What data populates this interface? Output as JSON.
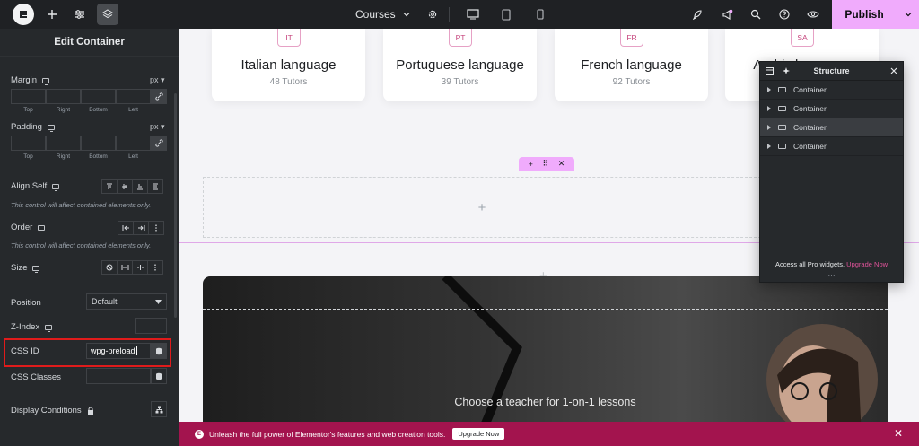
{
  "topbar": {
    "page_name": "Courses",
    "publish_label": "Publish"
  },
  "panel": {
    "title": "Edit Container",
    "margin": {
      "label": "Margin",
      "unit": "px",
      "sides": [
        "Top",
        "Right",
        "Bottom",
        "Left"
      ]
    },
    "padding": {
      "label": "Padding",
      "unit": "px",
      "sides": [
        "Top",
        "Right",
        "Bottom",
        "Left"
      ]
    },
    "align_self": {
      "label": "Align Self",
      "hint": "This control will affect contained elements only."
    },
    "order": {
      "label": "Order",
      "hint": "This control will affect contained elements only."
    },
    "size": {
      "label": "Size"
    },
    "position": {
      "label": "Position",
      "value": "Default"
    },
    "z_index": {
      "label": "Z-Index"
    },
    "css_id": {
      "label": "CSS ID",
      "value": "wpg-preload"
    },
    "css_classes": {
      "label": "CSS Classes"
    },
    "display_conditions": {
      "label": "Display Conditions"
    }
  },
  "canvas": {
    "cards": [
      {
        "code": "IT",
        "name": "Italian language",
        "tutors": "48 Tutors"
      },
      {
        "code": "PT",
        "name": "Portuguese language",
        "tutors": "39 Tutors"
      },
      {
        "code": "FR",
        "name": "French language",
        "tutors": "92 Tutors"
      },
      {
        "code": "SA",
        "name": "Arabic language",
        "tutors": ""
      }
    ],
    "hero_text": "Choose a teacher for 1-on-1 lessons"
  },
  "structure": {
    "title": "Structure",
    "items": [
      "Container",
      "Container",
      "Container",
      "Container"
    ],
    "footer_text": "Access all Pro widgets.",
    "footer_link": "Upgrade Now"
  },
  "promo": {
    "message": "Unleash the full power of Elementor's features and web creation tools.",
    "cta": "Upgrade Now"
  },
  "colors": {
    "accent": "#f0abfc",
    "promo_bg": "#a3144e",
    "highlight_box": "#e01b1b"
  }
}
